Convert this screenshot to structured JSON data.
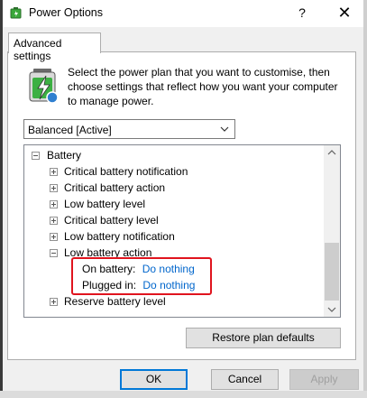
{
  "window": {
    "title": "Power Options",
    "help_glyph": "?",
    "close_glyph": "✕"
  },
  "tab": {
    "label": "Advanced settings"
  },
  "description": "Select the power plan that you want to customise, then choose settings that reflect how you want your computer to manage power.",
  "plan": {
    "selected": "Balanced [Active]"
  },
  "tree": {
    "group": "Battery",
    "items": [
      "Critical battery notification",
      "Critical battery action",
      "Low battery level",
      "Critical battery level",
      "Low battery notification"
    ],
    "expanded_item": "Low battery action",
    "settings": [
      {
        "label": "On battery:",
        "value": "Do nothing"
      },
      {
        "label": "Plugged in:",
        "value": "Do nothing"
      }
    ],
    "last_item": "Reserve battery level"
  },
  "buttons": {
    "restore": "Restore plan defaults",
    "ok": "OK",
    "cancel": "Cancel",
    "apply": "Apply"
  },
  "colors": {
    "link": "#0066cc",
    "highlight": "#e0141e",
    "accent": "#0078d7"
  }
}
